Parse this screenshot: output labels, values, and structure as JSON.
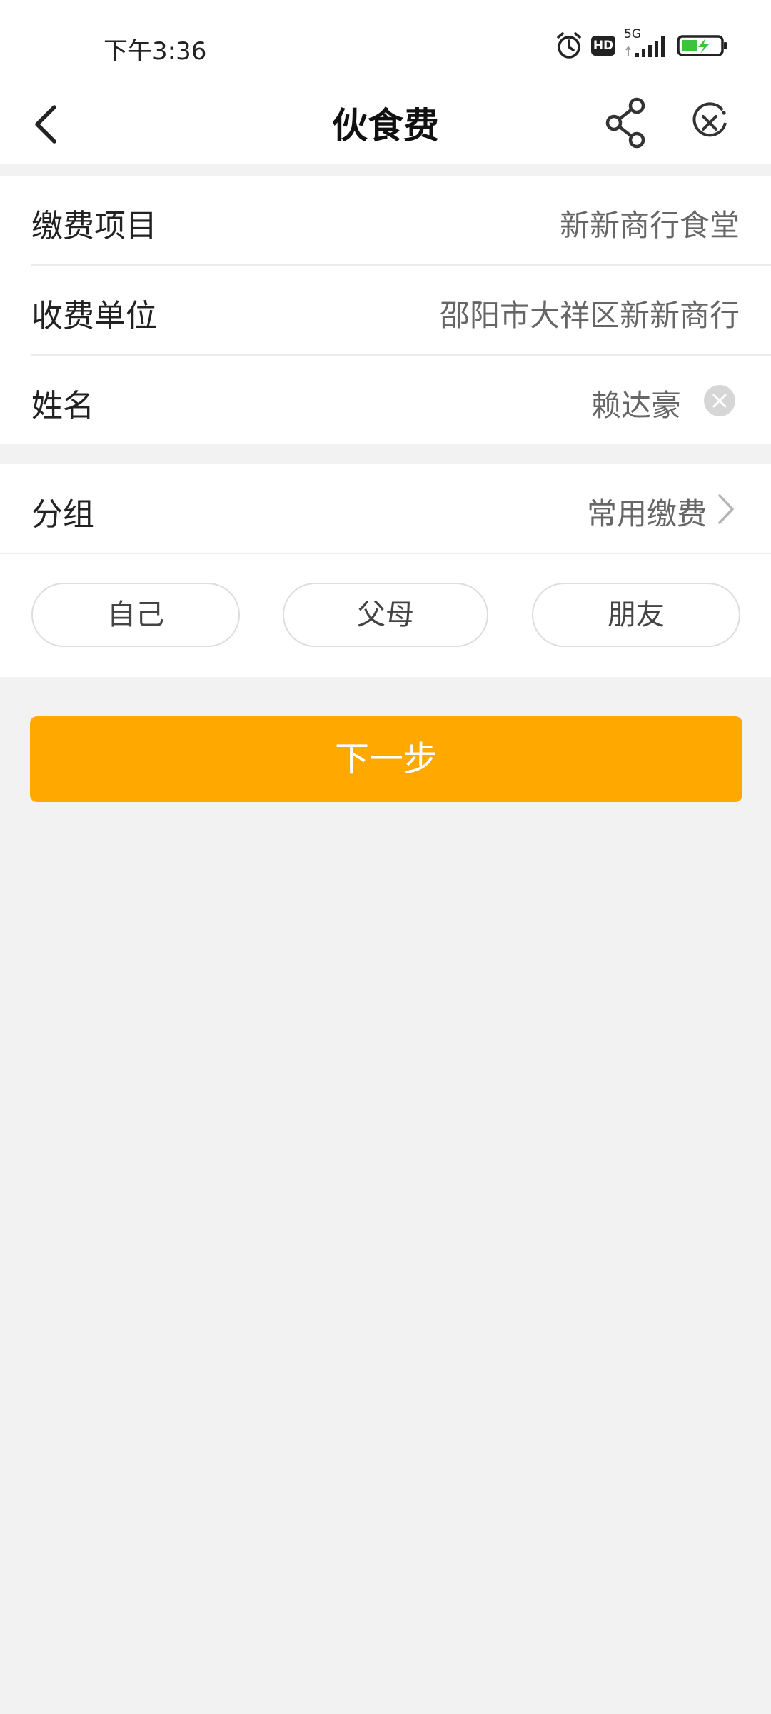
{
  "status_bar": {
    "time": "下午3:36",
    "icons": [
      "alarm-icon",
      "hd-icon",
      "5g-signal-icon",
      "battery-charging-icon"
    ],
    "network_label": "5G",
    "hd_label": "HD"
  },
  "nav": {
    "title": "伙食费",
    "back_icon": "chevron-left-icon",
    "share_icon": "share-icon",
    "close_icon": "close-circle-icon"
  },
  "form": {
    "rows": [
      {
        "label": "缴费项目",
        "value": "新新商行食堂"
      },
      {
        "label": "收费单位",
        "value": "邵阳市大祥区新新商行"
      },
      {
        "label": "姓名",
        "value": "赖达豪"
      }
    ],
    "group": {
      "label": "分组",
      "value": "常用缴费"
    },
    "chips": [
      "自己",
      "父母",
      "朋友"
    ]
  },
  "actions": {
    "next_label": "下一步"
  },
  "colors": {
    "accent": "#fea800",
    "background": "#f2f2f2",
    "card": "#ffffff"
  }
}
